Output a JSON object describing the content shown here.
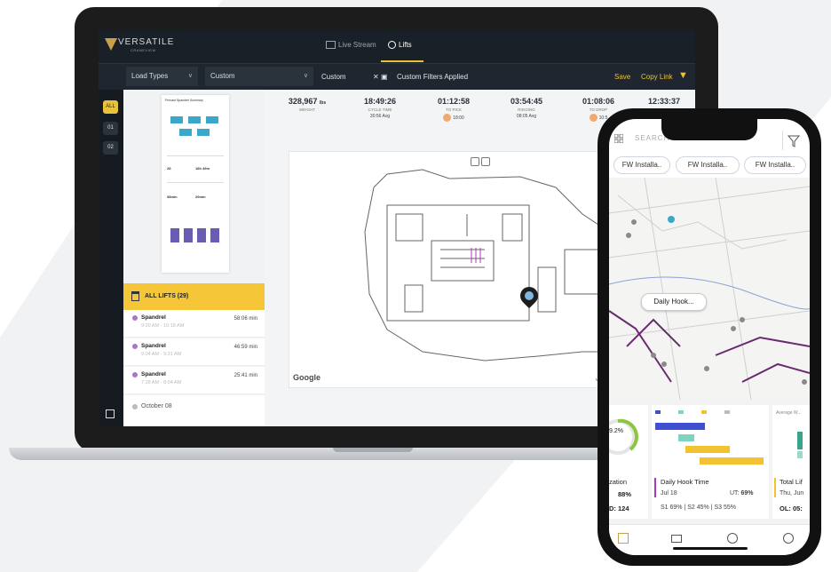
{
  "app": {
    "logo": "VERSATILE",
    "logo_sub": "CRANEVIEW"
  },
  "tabs": [
    {
      "label": "Live Stream"
    },
    {
      "label": "Lifts"
    }
  ],
  "filters": {
    "all_label": "ALL",
    "load_types": "Load Types",
    "custom1": "Custom",
    "custom2": "Custom",
    "applied": "Custom Filters Applied",
    "save": "Save",
    "copy_link": "Copy Link"
  },
  "rail": [
    "01",
    "02"
  ],
  "report": {
    "title": "Precast Spandrel Summary",
    "total_time_a": "28",
    "total_time_b": "18h 49m",
    "avg_a": "38min",
    "avg_b": "29min"
  },
  "stats": [
    {
      "value": "328,967",
      "unit": "lbs",
      "label": "WEIGHT",
      "sub": ""
    },
    {
      "value": "18:49:26",
      "label": "CYCLE TIME",
      "sub": "30:56 Avg"
    },
    {
      "value": "01:12:58",
      "label": "TO PICK",
      "sub": "18:00"
    },
    {
      "value": "03:54:45",
      "label": "RIGGING",
      "sub": "08:05 Avg"
    },
    {
      "value": "01:08:06",
      "label": "TO DROP",
      "sub": "10:5"
    },
    {
      "value": "12:33:37",
      "label": "",
      "sub": ""
    }
  ],
  "lifts": {
    "header": "ALL LIFTS (29)",
    "items": [
      {
        "name": "Spandrel",
        "time": "9:20 AM - 10:18 AM",
        "duration": "58:06 min"
      },
      {
        "name": "Spandrel",
        "time": "9:04 AM - 9:31 AM",
        "duration": "46:59 min"
      },
      {
        "name": "Spandrel",
        "time": "7:28 AM - 8:04 AM",
        "duration": "25:41 min"
      }
    ],
    "date": "October 08"
  },
  "map": {
    "google": "Google",
    "attribution": "Map data ©2020 Google"
  },
  "phone": {
    "search_placeholder": "SEARCH",
    "chips": [
      "FW Installa..",
      "FW Installa..",
      "FW Installa.."
    ],
    "tooltip": "Daily Hook...",
    "donut_value": "9.2",
    "cards": [
      {
        "title": "zation",
        "value": "88%",
        "extra": "D: 124"
      },
      {
        "title": "Daily Hook Time",
        "date": "Jul 18",
        "ut_label": "UT:",
        "ut_value": "69%",
        "breakdown": "S1 69%  |  S2 45%  |  S3 55%"
      },
      {
        "title": "Total Lif",
        "date": "Thu, Jun",
        "extra": "OL: 05:"
      }
    ],
    "legend": [
      "Sub 1",
      "Sub 2",
      "Sub 3",
      "Sub 4"
    ],
    "avg_label": "Average W..."
  },
  "colors": {
    "accent": "#e8c33a",
    "panel": "#1d232b",
    "purple": "#a978c2"
  }
}
